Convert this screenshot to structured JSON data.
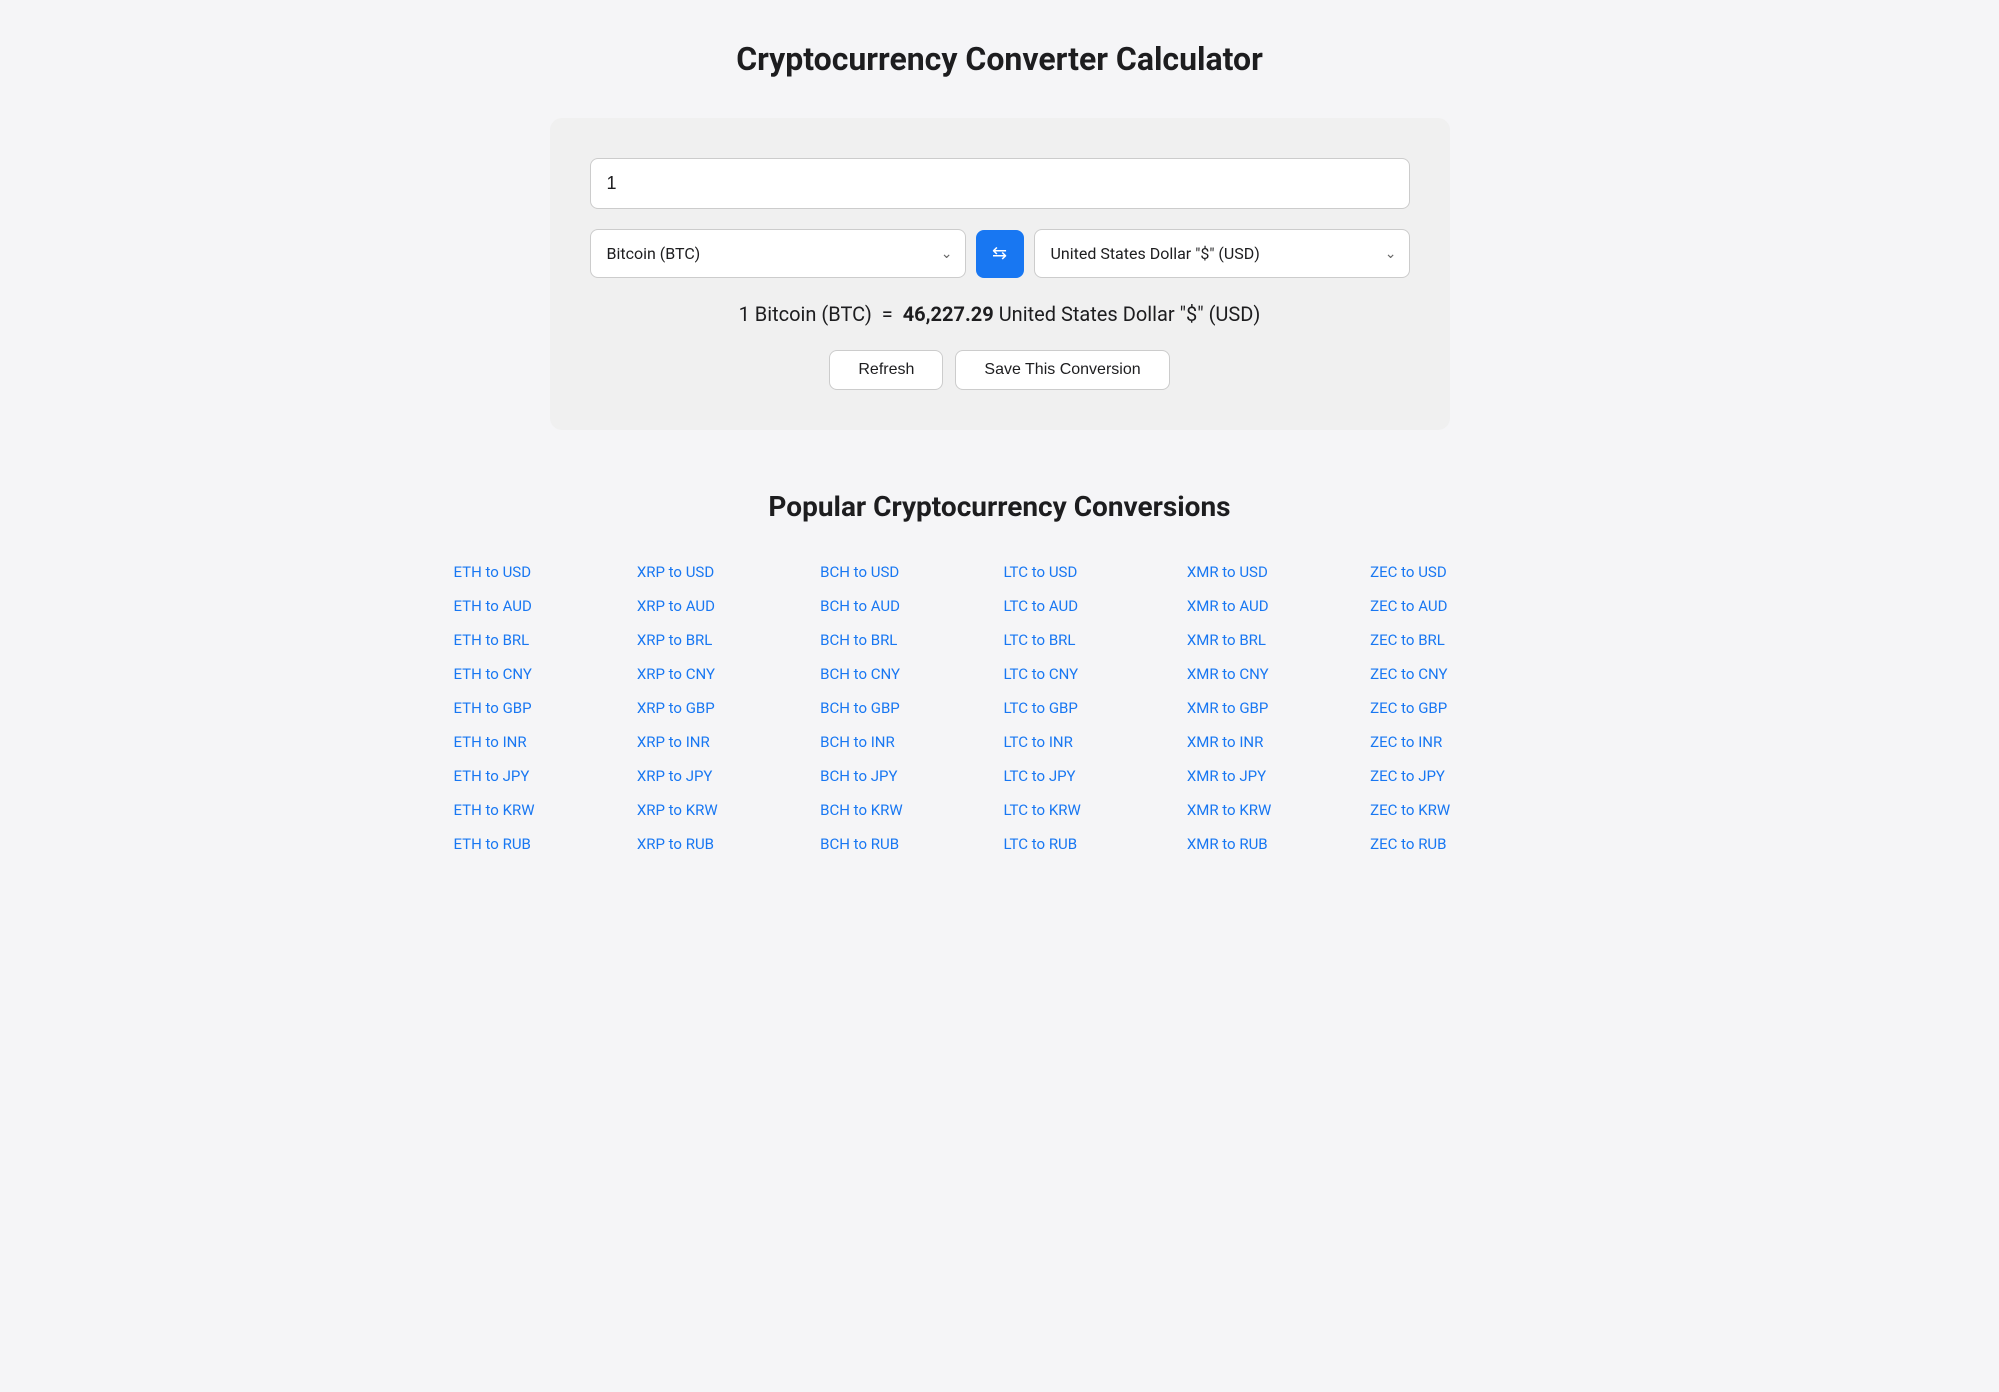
{
  "page": {
    "title": "Cryptocurrency Converter Calculator"
  },
  "converter": {
    "amount_value": "1",
    "from_currency": "Bitcoin (BTC)",
    "to_currency": "United States Dollar \"$\" (USD)",
    "result_label": "1 Bitcoin (BTC)",
    "result_equals": "=",
    "result_value": "46,227.29",
    "result_currency": "United States Dollar \"$\" (USD)",
    "refresh_label": "Refresh",
    "save_label": "Save This Conversion",
    "swap_icon": "⇄"
  },
  "popular": {
    "title": "Popular Cryptocurrency Conversions",
    "columns": [
      {
        "links": [
          "ETH to USD",
          "ETH to AUD",
          "ETH to BRL",
          "ETH to CNY",
          "ETH to GBP",
          "ETH to INR",
          "ETH to JPY",
          "ETH to KRW",
          "ETH to RUB"
        ]
      },
      {
        "links": [
          "XRP to USD",
          "XRP to AUD",
          "XRP to BRL",
          "XRP to CNY",
          "XRP to GBP",
          "XRP to INR",
          "XRP to JPY",
          "XRP to KRW",
          "XRP to RUB"
        ]
      },
      {
        "links": [
          "BCH to USD",
          "BCH to AUD",
          "BCH to BRL",
          "BCH to CNY",
          "BCH to GBP",
          "BCH to INR",
          "BCH to JPY",
          "BCH to KRW",
          "BCH to RUB"
        ]
      },
      {
        "links": [
          "LTC to USD",
          "LTC to AUD",
          "LTC to BRL",
          "LTC to CNY",
          "LTC to GBP",
          "LTC to INR",
          "LTC to JPY",
          "LTC to KRW",
          "LTC to RUB"
        ]
      },
      {
        "links": [
          "XMR to USD",
          "XMR to AUD",
          "XMR to BRL",
          "XMR to CNY",
          "XMR to GBP",
          "XMR to INR",
          "XMR to JPY",
          "XMR to KRW",
          "XMR to RUB"
        ]
      },
      {
        "links": [
          "ZEC to USD",
          "ZEC to AUD",
          "ZEC to BRL",
          "ZEC to CNY",
          "ZEC to GBP",
          "ZEC to INR",
          "ZEC to JPY",
          "ZEC to KRW",
          "ZEC to RUB"
        ]
      }
    ]
  }
}
